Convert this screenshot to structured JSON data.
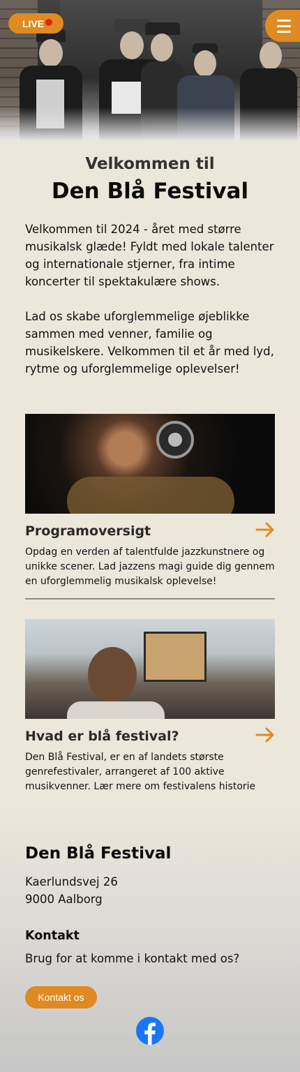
{
  "header": {
    "live_label": "LIVE",
    "accent_color": "#df8a22",
    "live_dot_color": "#e2231a",
    "menu_icon": "hamburger-menu-icon",
    "hero_image": "band-photo"
  },
  "intro": {
    "subtitle": "Velkommen til",
    "title": "Den Blå Festival",
    "paragraphs": [
      "Velkommen til 2024 - året med større musikalsk glæde! Fyldt med lokale talenter og internationale stjerner, fra intime koncerter til spektakulære shows.",
      "Lad os skabe uforglemmelige øjeblikke sammen med venner, familie og musikelskere. Velkommen til et år med lyd, rytme og uforglemmelige oplevelser!"
    ]
  },
  "cards": [
    {
      "title": "Programoversigt",
      "text": "Opdag en verden af talentfulde jazzkunstnere og unikke scener. Lad jazzens magi guide dig gennem en uforglemmelig musikalsk oplevelse!",
      "icon": "arrow-right-icon"
    },
    {
      "title": "Hvad er blå festival?",
      "text": "Den Blå Festival, er en af landets største genrefestivaler, arrangeret af 100 aktive musikvenner. Lær mere om festivalens historie",
      "icon": "arrow-right-icon"
    }
  ],
  "footer": {
    "title": "Den Blå Festival",
    "address_line1": "Kaerlundsvej 26",
    "address_line2": "9000 Aalborg",
    "contact_heading": "Kontakt",
    "contact_text": "Brug for at komme i kontakt med os?",
    "contact_button": "Kontakt os",
    "social_icon": "facebook-icon",
    "facebook_color": "#1877f2"
  }
}
